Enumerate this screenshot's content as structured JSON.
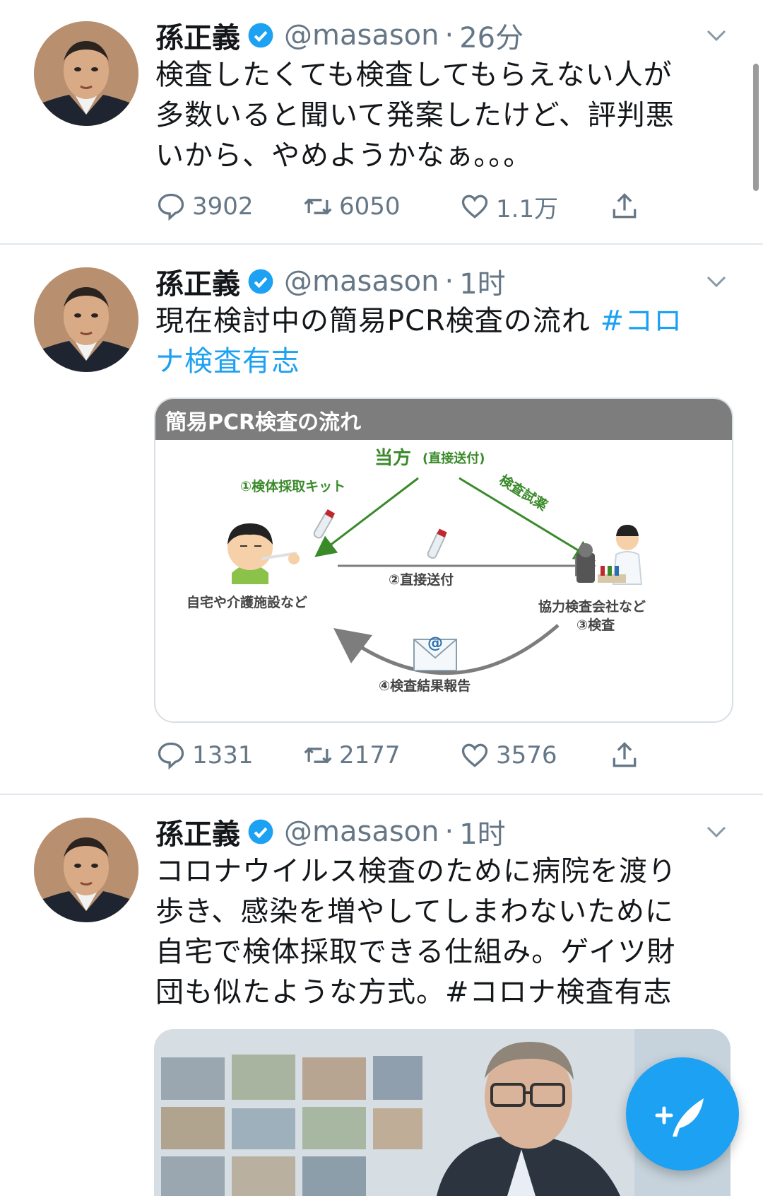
{
  "tweets": [
    {
      "name": "孫正義",
      "handle": "@masason",
      "sep": "·",
      "time": "26分",
      "lines": [
        "検査したくても検査してもらえない人が",
        "多数いると聞いて発案したけど、評判悪",
        "いから、やめようかなぁ。。。"
      ],
      "replies": "3902",
      "retweets": "6050",
      "likes": "1.1万"
    },
    {
      "name": "孫正義",
      "handle": "@masason",
      "sep": "·",
      "time": "1时",
      "line1_text": "現在検討中の簡易PCR検査の流れ ",
      "line1_tag": "#コロ",
      "line2_tag": "ナ検査有志",
      "replies": "1331",
      "retweets": "2177",
      "likes": "3576",
      "card": {
        "title": "簡易PCR検査の流れ",
        "top_node": "当方",
        "top_node_sub": "(直接送付)",
        "step1": "①検体採取キット",
        "step_test": "検査試薬",
        "step2": "②直接送付",
        "left_node": "自宅や介護施設など",
        "right_node": "協力検査会社など",
        "right_sub": "③検査",
        "step4": "④検査結果報告",
        "at": "@"
      }
    },
    {
      "name": "孫正義",
      "handle": "@masason",
      "sep": "·",
      "time": "1时",
      "lines": [
        "コロナウイルス検査のために病院を渡り",
        "歩き、感染を増やしてしまわないために",
        "自宅で検体採取できる仕組み。ゲイツ財",
        "団も似たような方式。#コロナ検査有志"
      ]
    }
  ],
  "colors": {
    "accent": "#1da1f2",
    "muted": "#657786",
    "green": "#3a8a2a"
  },
  "icons": [
    "verified-icon",
    "chevron-down-icon",
    "reply-icon",
    "retweet-icon",
    "like-icon",
    "share-icon",
    "compose-tweet-icon"
  ]
}
